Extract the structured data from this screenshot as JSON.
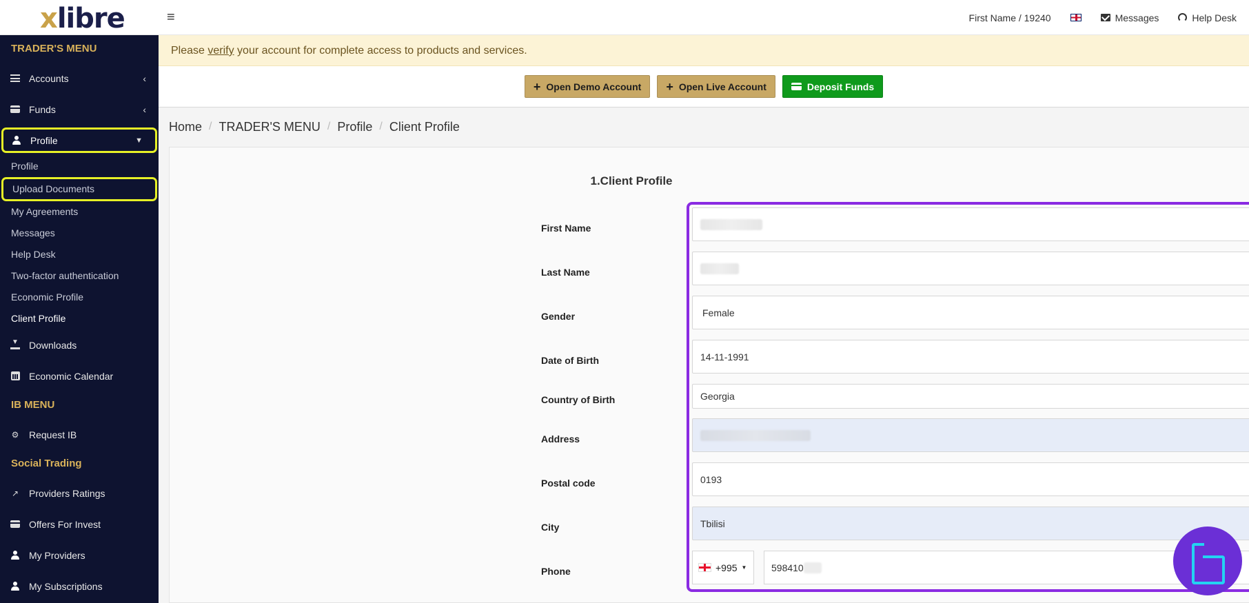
{
  "logo": {
    "x": "x",
    "rest": "libre"
  },
  "topbar": {
    "user": "First Name / 19240",
    "messages": "Messages",
    "help_desk": "Help Desk"
  },
  "sidebar": {
    "traders_menu": "TRADER'S MENU",
    "accounts": "Accounts",
    "funds": "Funds",
    "profile": "Profile",
    "sub": [
      "Profile",
      "Upload Documents",
      "My Agreements",
      "Messages",
      "Help Desk",
      "Two-factor authentication",
      "Economic Profile",
      "Client Profile"
    ],
    "downloads": "Downloads",
    "economic_calendar": "Economic Calendar",
    "ib_menu": "IB MENU",
    "request_ib": "Request IB",
    "social_trading": "Social Trading",
    "providers_ratings": "Providers Ratings",
    "offers_for_invest": "Offers For Invest",
    "my_providers": "My Providers",
    "my_subscriptions": "My Subscriptions"
  },
  "alert": {
    "prefix": "Please ",
    "link": "verify",
    "suffix": " your account for complete access to products and services."
  },
  "actions": {
    "open_demo": "Open Demo Account",
    "open_live": "Open Live Account",
    "deposit": "Deposit Funds"
  },
  "breadcrumb": [
    "Home",
    "TRADER'S MENU",
    "Profile",
    "Client Profile"
  ],
  "form": {
    "title": "1.Client Profile",
    "labels": {
      "first_name": "First Name",
      "last_name": "Last Name",
      "gender": "Gender",
      "dob": "Date of Birth",
      "country": "Country of Birth",
      "address": "Address",
      "postal": "Postal code",
      "city": "City",
      "phone": "Phone"
    },
    "values": {
      "gender": "Female",
      "dob": "14-11-1991",
      "country": "Georgia",
      "postal": "0193",
      "city": "Tbilisi",
      "phone_code": "+995",
      "phone_number": "598410"
    }
  }
}
